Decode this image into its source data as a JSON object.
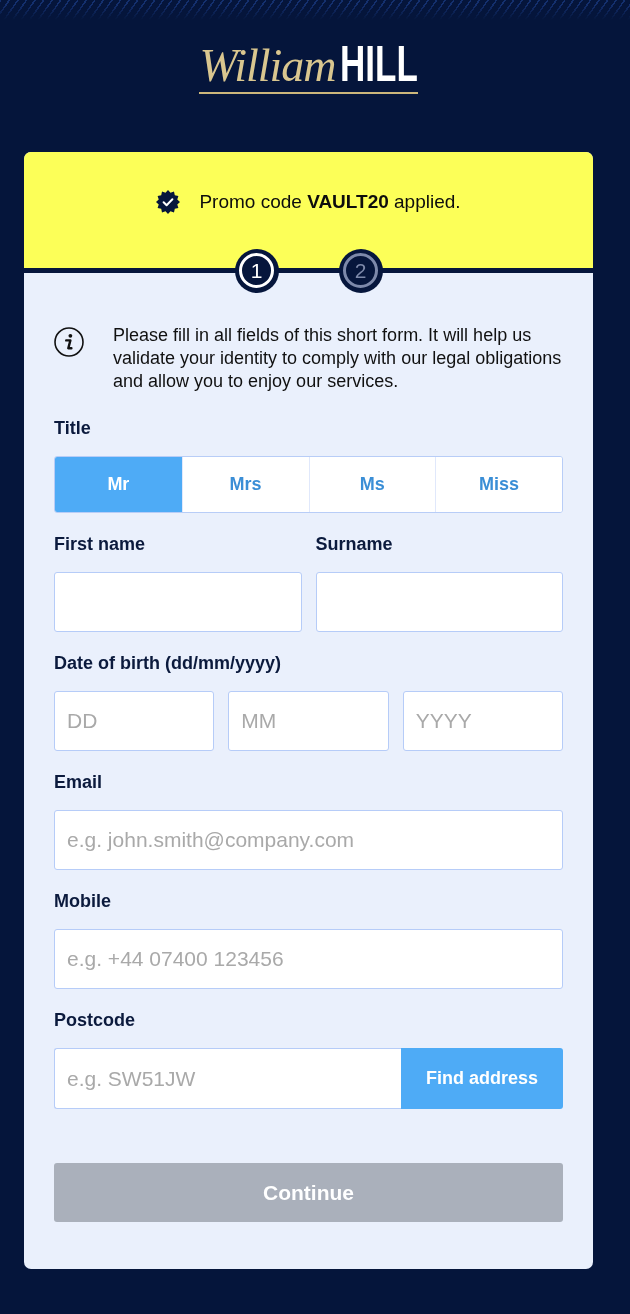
{
  "logo": {
    "script": "William",
    "wordmark": "HILL"
  },
  "promo": {
    "text": "Promo code **VAULT20** applied."
  },
  "steps": [
    {
      "label": "1",
      "selected": true
    },
    {
      "label": "2",
      "selected": false
    }
  ],
  "info": {
    "text": "Please fill in all fields of this short form. It will help us validate your identity to comply with our legal obligations and allow you to enjoy our services."
  },
  "title": {
    "label": "Title",
    "options": [
      {
        "label": "Mr",
        "selected": true
      },
      {
        "label": "Mrs",
        "selected": false
      },
      {
        "label": "Ms",
        "selected": false
      },
      {
        "label": "Miss",
        "selected": false
      }
    ]
  },
  "rows": [
    {
      "kind": "pair",
      "fields": [
        {
          "label": "First name"
        },
        {
          "label": "Surname"
        }
      ]
    },
    {
      "kind": "date",
      "label": "Date of birth (dd/mm/yyyy)",
      "inputs": [
        {
          "placeholder": "DD"
        },
        {
          "placeholder": "MM"
        },
        {
          "placeholder": "YYYY"
        }
      ]
    },
    {
      "kind": "text",
      "label": "Email",
      "placeholder": "e.g. john.smith@company.com"
    },
    {
      "kind": "text",
      "label": "Mobile",
      "placeholder": "e.g. +44 07400 123456"
    },
    {
      "kind": "lookup",
      "label": "Postcode",
      "placeholder": "e.g. SW51JW",
      "button": "Find address"
    }
  ],
  "continue_button": {
    "label": "Continue",
    "disabled": true
  }
}
